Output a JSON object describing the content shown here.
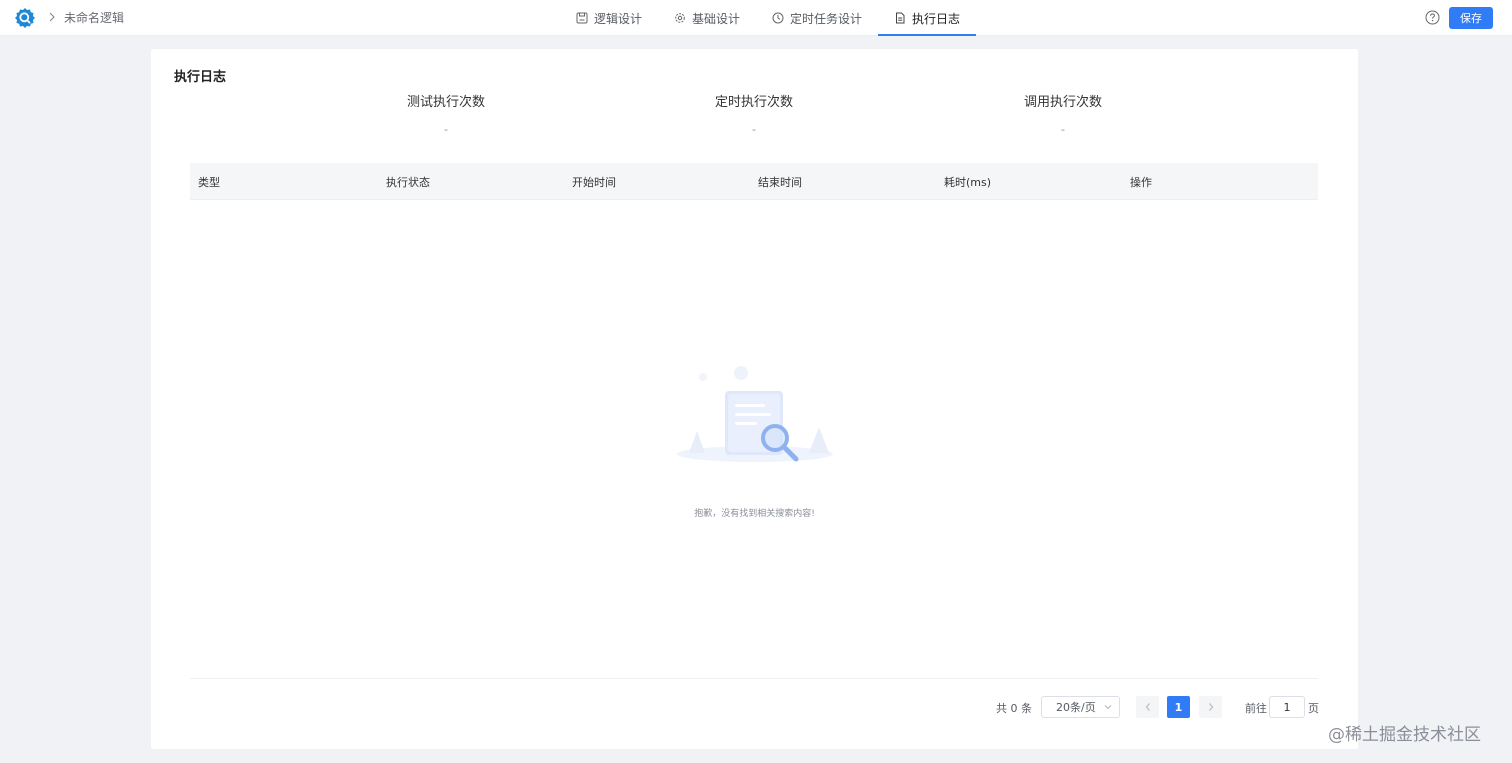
{
  "header": {
    "breadcrumb_title": "未命名逻辑",
    "tabs": [
      {
        "label": "逻辑设计",
        "icon": "save-icon"
      },
      {
        "label": "基础设计",
        "icon": "gear-icon"
      },
      {
        "label": "定时任务设计",
        "icon": "clock-icon"
      },
      {
        "label": "执行日志",
        "icon": "document-icon",
        "active": true
      }
    ],
    "save_label": "保存"
  },
  "panel": {
    "title": "执行日志",
    "stats": [
      {
        "label": "测试执行次数",
        "value": "-"
      },
      {
        "label": "定时执行次数",
        "value": "-"
      },
      {
        "label": "调用执行次数",
        "value": "-"
      }
    ],
    "table": {
      "columns": [
        "类型",
        "执行状态",
        "开始时间",
        "结束时间",
        "耗时(ms)",
        "操作"
      ],
      "rows": []
    },
    "empty_text": "抱歉，没有找到相关搜索内容!"
  },
  "pagination": {
    "total_text": "共 0 条",
    "page_size": "20条/页",
    "current_page": "1",
    "goto_label": "前往",
    "goto_value": "1",
    "goto_unit": "页"
  },
  "watermark": "@稀土掘金技术社区",
  "colors": {
    "accent": "#2f7cf6",
    "background": "#f0f2f5"
  }
}
